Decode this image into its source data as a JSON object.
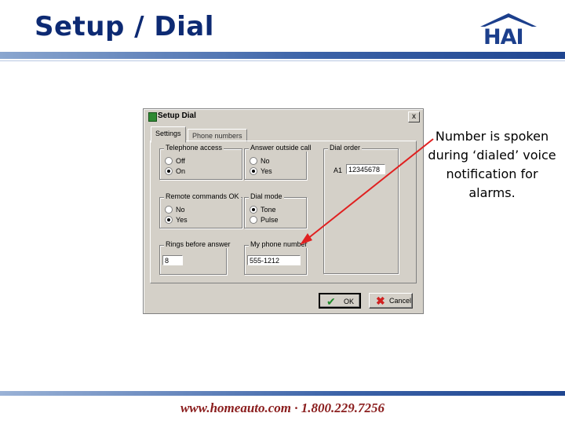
{
  "slide": {
    "title": "Setup / Dial",
    "logo_text": "HAI",
    "callout": "Number is spoken during ‘dialed’ voice notification for alarms.",
    "footer": "www.homeauto.com · 1.800.229.7256"
  },
  "dialog": {
    "title": "Setup Dial",
    "close_label": "x",
    "tabs": [
      {
        "label": "Settings",
        "active": true
      },
      {
        "label": "Phone numbers",
        "active": false
      }
    ],
    "groups": {
      "telephone_access": {
        "label": "Telephone access",
        "options": [
          {
            "label": "Off",
            "selected": false
          },
          {
            "label": "On",
            "selected": true
          }
        ]
      },
      "answer_outside_call": {
        "label": "Answer outside call",
        "options": [
          {
            "label": "No",
            "selected": false
          },
          {
            "label": "Yes",
            "selected": true
          }
        ]
      },
      "remote_commands_ok": {
        "label": "Remote commands OK",
        "options": [
          {
            "label": "No",
            "selected": false
          },
          {
            "label": "Yes",
            "selected": true
          }
        ]
      },
      "dial_mode": {
        "label": "Dial mode",
        "options": [
          {
            "label": "Tone",
            "selected": true
          },
          {
            "label": "Pulse",
            "selected": false
          }
        ]
      },
      "rings_before_answer": {
        "label": "Rings before answer",
        "value": "8"
      },
      "my_phone_number": {
        "label": "My phone number",
        "value": "555-1212"
      },
      "dial_order": {
        "label": "Dial order",
        "entry_label": "A1",
        "entry_value": "12345678"
      }
    },
    "buttons": {
      "ok_label": "OK",
      "cancel_label": "Cancel"
    }
  },
  "colors": {
    "title_blue": "#0d2a73",
    "footer_red": "#8a1c1c",
    "arrow_red": "#e02020",
    "dialog_gray": "#d4d0c8"
  },
  "icons": {
    "ok": "checkmark-icon",
    "cancel": "x-icon",
    "title": "app-icon"
  }
}
